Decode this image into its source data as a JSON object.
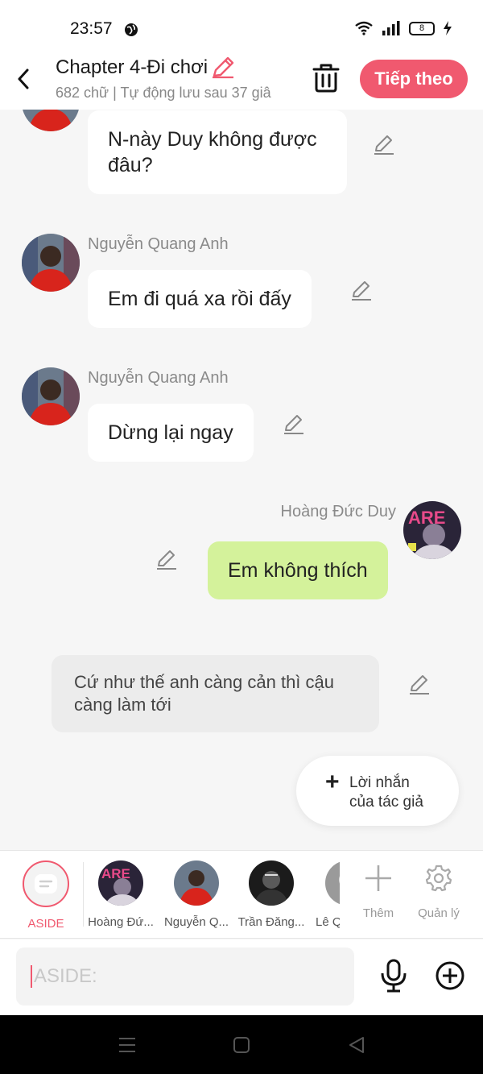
{
  "status": {
    "time": "23:57",
    "battery": "8"
  },
  "header": {
    "title": "Chapter 4-Đi chơi",
    "subtitle": "682 chữ | Tự động lưu sau 37 giâ",
    "next_label": "Tiếp theo"
  },
  "messages": [
    {
      "sender": "",
      "text": "N-này Duy không được đâu?"
    },
    {
      "sender": "Nguyễn Quang Anh",
      "text": "Em đi quá xa rồi đấy"
    },
    {
      "sender": "Nguyễn Quang Anh",
      "text": "Dừng lại ngay"
    },
    {
      "sender": "Hoàng Đức Duy",
      "text": "Em không thích"
    }
  ],
  "aside_message": {
    "text": "Cứ như thế anh càng cản thì cậu càng làm tới"
  },
  "author_note": {
    "plus": "+",
    "label_line1": "Lời nhắn",
    "label_line2": "của tác giả"
  },
  "characters": {
    "aside_label": "ASIDE",
    "items": [
      {
        "label": "Hoàng Đứ..."
      },
      {
        "label": "Nguyễn Q..."
      },
      {
        "label": "Trần Đăng..."
      },
      {
        "label": "Lê Q"
      }
    ],
    "add_label": "Thêm",
    "manage_label": "Quản lý"
  },
  "input": {
    "placeholder": "ASIDE:"
  },
  "colors": {
    "accent": "#f0596f",
    "my_bubble": "#d4f29b",
    "aside_bubble": "#ececec"
  }
}
